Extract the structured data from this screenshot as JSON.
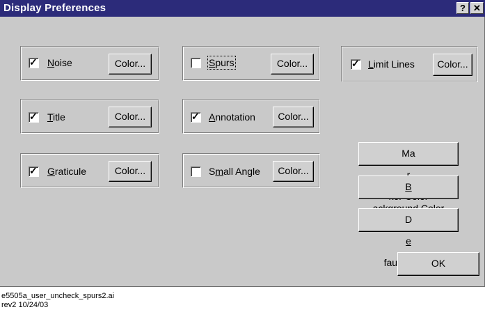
{
  "window": {
    "title": "Display Preferences",
    "help_button": "?",
    "close_button": "✕"
  },
  "groups": [
    {
      "name": "noise",
      "checked": true,
      "label_pre": "",
      "label_ul": "N",
      "label_post": "oise",
      "color_label": "Color..."
    },
    {
      "name": "spurs",
      "checked": false,
      "label_pre": "",
      "label_ul": "S",
      "label_post": "purs",
      "color_label": "Color..."
    },
    {
      "name": "limit-lines",
      "checked": true,
      "label_pre": "",
      "label_ul": "L",
      "label_post": "imit Lines",
      "color_label": "Color..."
    },
    {
      "name": "title",
      "checked": true,
      "label_pre": "",
      "label_ul": "T",
      "label_post": "itle",
      "color_label": "Color..."
    },
    {
      "name": "annotation",
      "checked": true,
      "label_pre": "",
      "label_ul": "A",
      "label_post": "nnotation",
      "color_label": "Color..."
    },
    {
      "name": "graticule",
      "checked": true,
      "label_pre": "",
      "label_ul": "G",
      "label_post": "raticule",
      "color_label": "Color..."
    },
    {
      "name": "small-angle",
      "checked": false,
      "label_pre": "S",
      "label_ul": "m",
      "label_post": "all Angle",
      "color_label": "Color..."
    }
  ],
  "buttons": {
    "marker_color": {
      "pre": "Ma",
      "ul": "r",
      "post": "ker Color"
    },
    "background_color": {
      "pre": "",
      "ul": "B",
      "post": "ackground Color"
    },
    "default_colors": {
      "pre": "D",
      "ul": "e",
      "post": "fault Colors"
    },
    "ok": "OK"
  },
  "caption": {
    "line1": "e5505a_user_uncheck_spurs2.ai",
    "line2": "rev2 10/24/03"
  }
}
